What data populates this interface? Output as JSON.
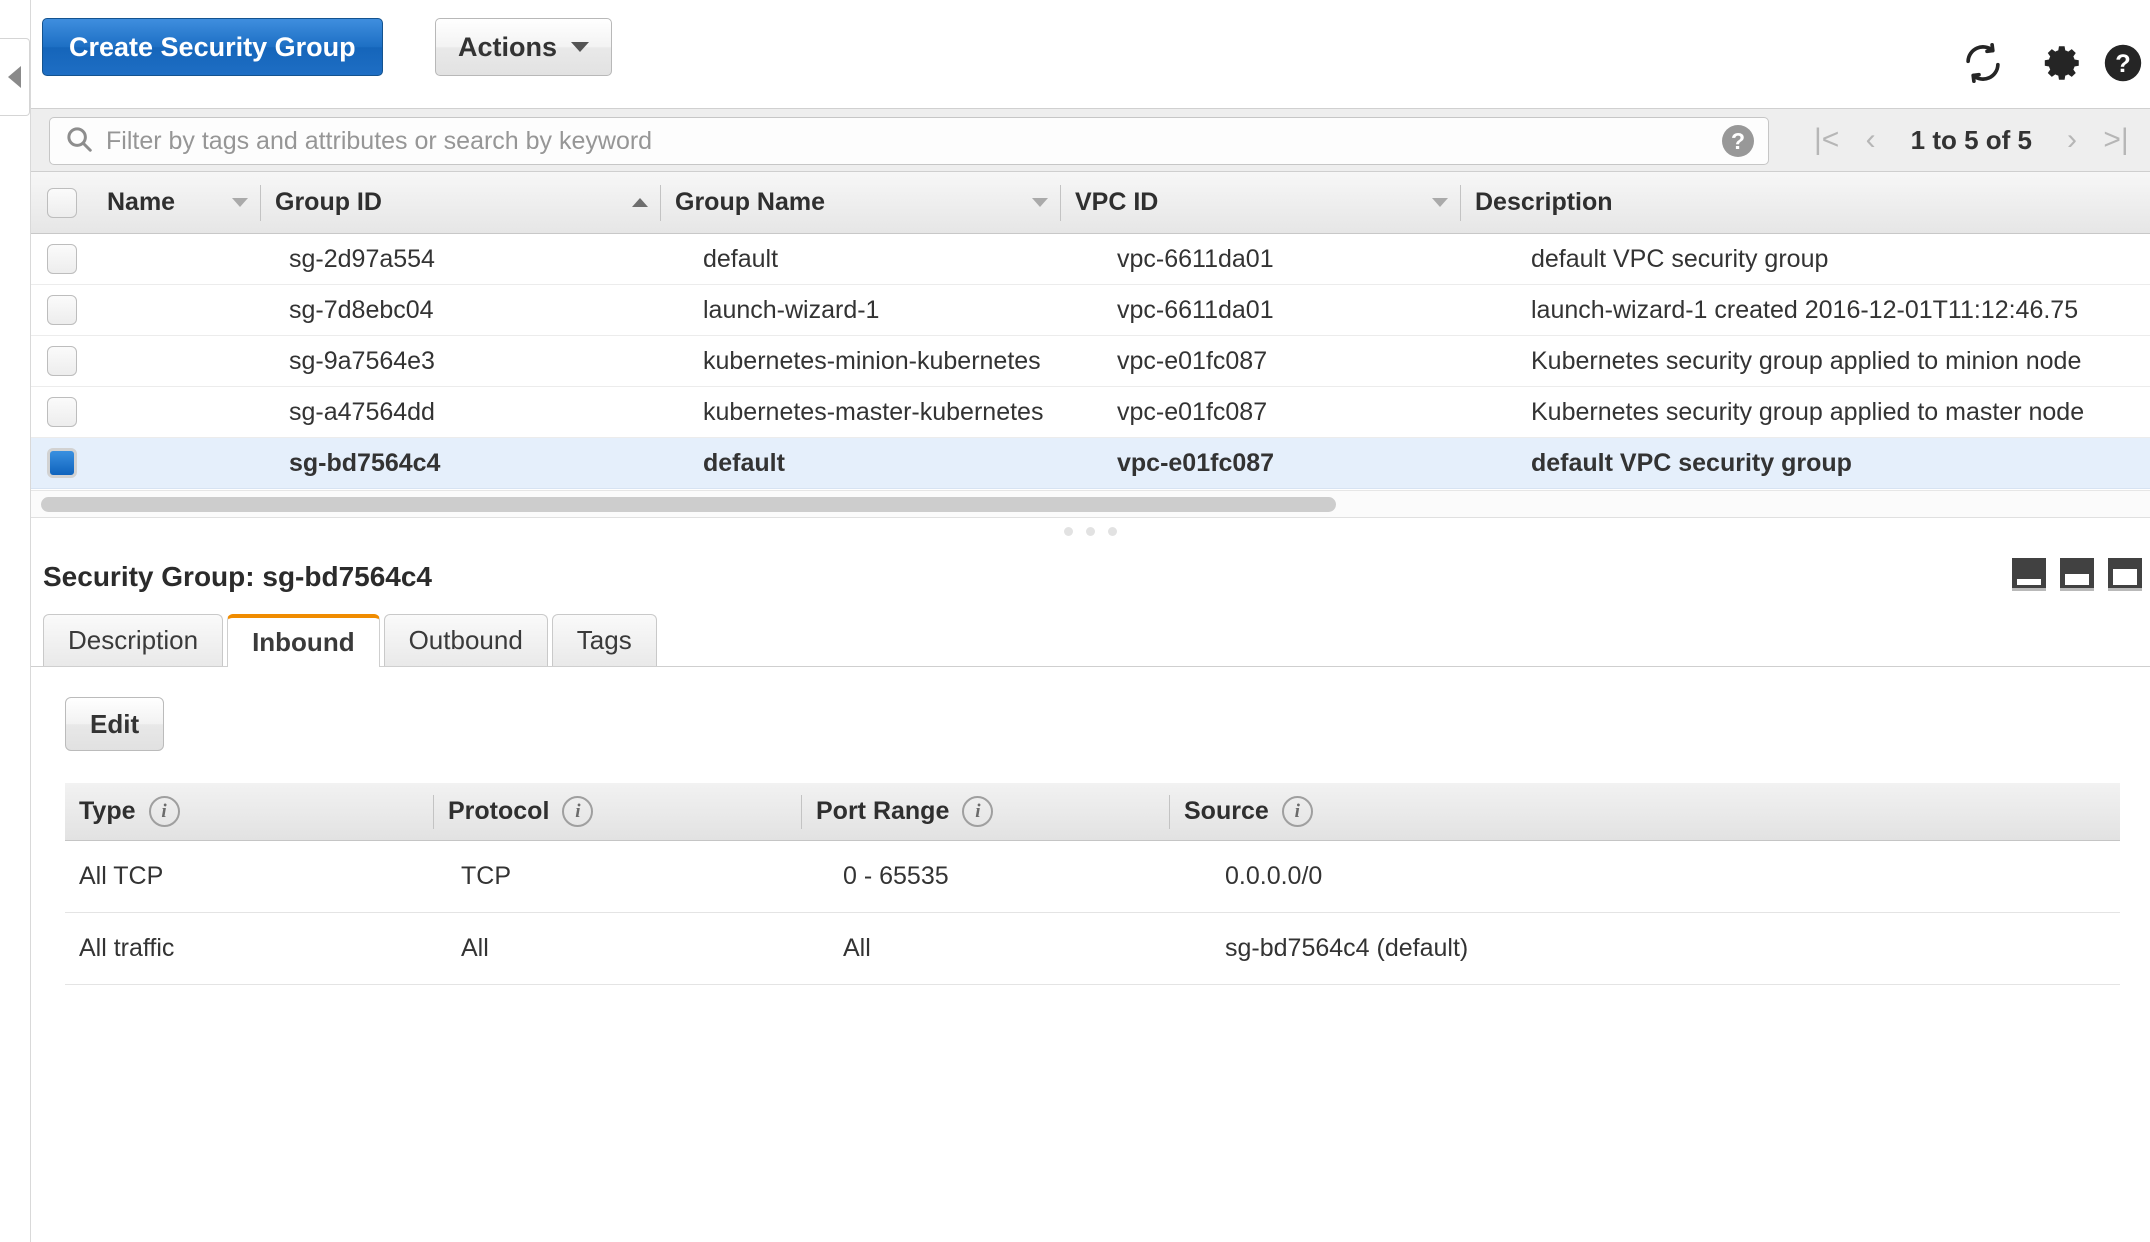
{
  "toolbar": {
    "create_label": "Create Security Group",
    "actions_label": "Actions",
    "refresh_icon": "refresh-icon",
    "settings_icon": "gear-icon",
    "help_icon": "help-circle-icon"
  },
  "filterbar": {
    "search_placeholder": "Filter by tags and attributes or search by keyword",
    "search_value": "",
    "search_icon": "search-icon",
    "help_icon": "help-circle-icon",
    "pager": {
      "first": "|<",
      "prev": "‹",
      "label": "1 to 5 of 5",
      "next": "›",
      "last": ">|"
    }
  },
  "sg_table": {
    "columns": [
      {
        "label": "Name",
        "sort": "down"
      },
      {
        "label": "Group ID",
        "sort": "up"
      },
      {
        "label": "Group Name",
        "sort": "down"
      },
      {
        "label": "VPC ID",
        "sort": "down"
      },
      {
        "label": "Description",
        "sort": "none"
      }
    ],
    "rows": [
      {
        "selected": false,
        "name": "",
        "group_id": "sg-2d97a554",
        "group_name": "default",
        "vpc_id": "vpc-6611da01",
        "description": "default VPC security group"
      },
      {
        "selected": false,
        "name": "",
        "group_id": "sg-7d8ebc04",
        "group_name": "launch-wizard-1",
        "vpc_id": "vpc-6611da01",
        "description": "launch-wizard-1 created 2016-12-01T11:12:46.75"
      },
      {
        "selected": false,
        "name": "",
        "group_id": "sg-9a7564e3",
        "group_name": "kubernetes-minion-kubernetes",
        "vpc_id": "vpc-e01fc087",
        "description": "Kubernetes security group applied to minion node"
      },
      {
        "selected": false,
        "name": "",
        "group_id": "sg-a47564dd",
        "group_name": "kubernetes-master-kubernetes",
        "vpc_id": "vpc-e01fc087",
        "description": "Kubernetes security group applied to master node"
      },
      {
        "selected": true,
        "name": "",
        "group_id": "sg-bd7564c4",
        "group_name": "default",
        "vpc_id": "vpc-e01fc087",
        "description": "default VPC security group"
      }
    ]
  },
  "detail": {
    "title": "Security Group: sg-bd7564c4",
    "panel_modes": [
      "panel-minimize-icon",
      "panel-medium-icon",
      "panel-maximize-icon"
    ],
    "tabs": [
      {
        "label": "Description",
        "active": false
      },
      {
        "label": "Inbound",
        "active": true
      },
      {
        "label": "Outbound",
        "active": false
      },
      {
        "label": "Tags",
        "active": false
      }
    ],
    "edit_label": "Edit",
    "rules": {
      "columns": [
        "Type",
        "Protocol",
        "Port Range",
        "Source"
      ],
      "rows": [
        {
          "type": "All TCP",
          "protocol": "TCP",
          "port_range": "0 - 65535",
          "source": "0.0.0.0/0"
        },
        {
          "type": "All traffic",
          "protocol": "All",
          "port_range": "All",
          "source": "sg-bd7564c4 (default)"
        }
      ]
    }
  },
  "colors": {
    "primary_button": "#1d6fc4",
    "active_tab_accent": "#f08c00",
    "selected_row": "#e5effb",
    "checkbox_on": "#1a6ec2"
  }
}
